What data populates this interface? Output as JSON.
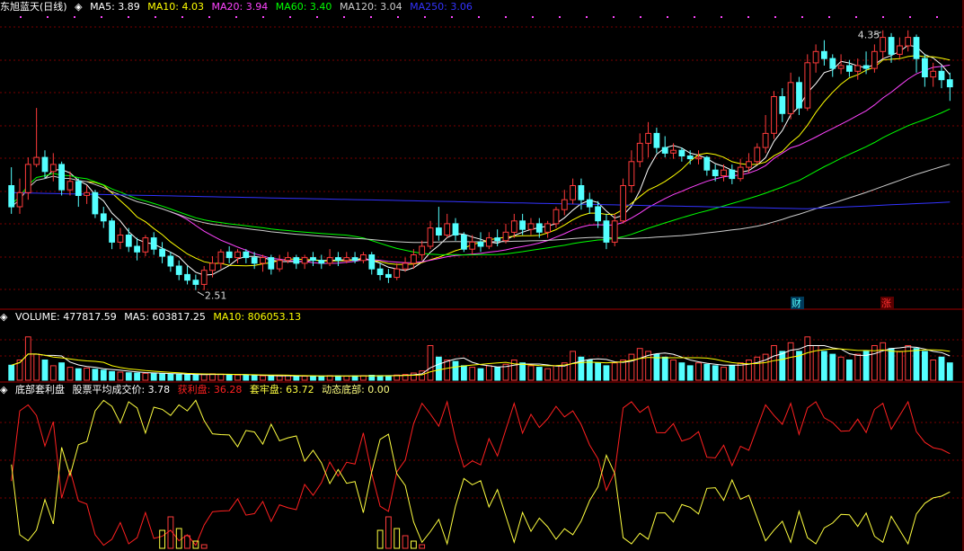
{
  "colors": {
    "up": "#ff3b3b",
    "down": "#54ffff",
    "grid": "#7a0000",
    "separator": "#a00000",
    "ma5": "#ffffff",
    "ma10": "#ffff00",
    "ma20": "#ff44ff",
    "ma60": "#00ff00",
    "ma120": "#cccccc",
    "ma250": "#3333ff",
    "profit": "#ff2020",
    "trapped": "#ffff40",
    "bottom": "#ffff80"
  },
  "price_panel": {
    "title": "东旭蓝天(日线)",
    "mas": [
      {
        "label": "MA5: 3.89",
        "color": "#ffffff"
      },
      {
        "label": "MA10: 4.03",
        "color": "#ffff00"
      },
      {
        "label": "MA20: 3.94",
        "color": "#ff44ff"
      },
      {
        "label": "MA60: 3.40",
        "color": "#00ff00"
      },
      {
        "label": "MA120: 3.04",
        "color": "#cccccc"
      },
      {
        "label": "MA250: 3.06",
        "color": "#3333ff"
      }
    ],
    "high_label": "4.35",
    "low_label": "2.51",
    "markers": [
      {
        "text": "财",
        "color": "#54ffff",
        "bg": "#003a5a"
      },
      {
        "text": "涨",
        "color": "#ff3030",
        "bg": "#5a0000"
      }
    ]
  },
  "volume_panel": {
    "title": "VOLUME: 477817.59",
    "ma5": "MA5: 603817.25",
    "ma10": "MA10: 806053.13"
  },
  "indicator_panel": {
    "title": "底部套利盘",
    "avg": "股票平均成交价: 3.78",
    "profit": "获利盘: 36.28",
    "trapped": "套牢盘: 63.72",
    "bottom": "动态底部: 0.00"
  },
  "chart_data": {
    "type": "candlestick",
    "price_range": [
      2.4,
      4.45
    ],
    "price_high": 4.35,
    "price_low": 2.51,
    "candles": [
      [
        3.25,
        3.1,
        3.38,
        3.05
      ],
      [
        3.1,
        3.2,
        3.3,
        3.05
      ],
      [
        3.2,
        3.4,
        3.45,
        3.15
      ],
      [
        3.4,
        3.45,
        3.8,
        3.38
      ],
      [
        3.45,
        3.35,
        3.5,
        3.3
      ],
      [
        3.35,
        3.4,
        3.48,
        3.28
      ],
      [
        3.4,
        3.22,
        3.42,
        3.18
      ],
      [
        3.22,
        3.28,
        3.35,
        3.18
      ],
      [
        3.28,
        3.18,
        3.3,
        3.1
      ],
      [
        3.18,
        3.2,
        3.25,
        3.12
      ],
      [
        3.2,
        3.05,
        3.22,
        3.02
      ],
      [
        3.05,
        3.0,
        3.1,
        2.95
      ],
      [
        3.0,
        2.85,
        3.02,
        2.8
      ],
      [
        2.85,
        2.9,
        2.95,
        2.8
      ],
      [
        2.9,
        2.82,
        2.95,
        2.78
      ],
      [
        2.82,
        2.78,
        2.88,
        2.72
      ],
      [
        2.78,
        2.88,
        2.9,
        2.75
      ],
      [
        2.88,
        2.8,
        2.92,
        2.76
      ],
      [
        2.8,
        2.75,
        2.85,
        2.7
      ],
      [
        2.75,
        2.68,
        2.78,
        2.64
      ],
      [
        2.68,
        2.62,
        2.72,
        2.58
      ],
      [
        2.62,
        2.58,
        2.68,
        2.55
      ],
      [
        2.58,
        2.55,
        2.62,
        2.51
      ],
      [
        2.55,
        2.65,
        2.68,
        2.51
      ],
      [
        2.65,
        2.7,
        2.75,
        2.6
      ],
      [
        2.7,
        2.78,
        2.8,
        2.66
      ],
      [
        2.78,
        2.74,
        2.82,
        2.7
      ],
      [
        2.74,
        2.78,
        2.8,
        2.7
      ],
      [
        2.78,
        2.74,
        2.8,
        2.7
      ],
      [
        2.74,
        2.7,
        2.78,
        2.66
      ],
      [
        2.7,
        2.74,
        2.76,
        2.64
      ],
      [
        2.74,
        2.66,
        2.76,
        2.62
      ],
      [
        2.66,
        2.72,
        2.76,
        2.64
      ],
      [
        2.72,
        2.74,
        2.78,
        2.7
      ],
      [
        2.74,
        2.7,
        2.76,
        2.66
      ],
      [
        2.7,
        2.74,
        2.76,
        2.66
      ],
      [
        2.74,
        2.72,
        2.78,
        2.68
      ],
      [
        2.72,
        2.7,
        2.76,
        2.66
      ],
      [
        2.7,
        2.74,
        2.8,
        2.68
      ],
      [
        2.74,
        2.72,
        2.78,
        2.68
      ],
      [
        2.72,
        2.74,
        2.78,
        2.7
      ],
      [
        2.74,
        2.72,
        2.78,
        2.7
      ],
      [
        2.72,
        2.76,
        2.78,
        2.7
      ],
      [
        2.76,
        2.66,
        2.78,
        2.62
      ],
      [
        2.66,
        2.62,
        2.7,
        2.58
      ],
      [
        2.62,
        2.6,
        2.66,
        2.56
      ],
      [
        2.6,
        2.66,
        2.7,
        2.58
      ],
      [
        2.66,
        2.7,
        2.74,
        2.64
      ],
      [
        2.7,
        2.76,
        2.8,
        2.66
      ],
      [
        2.76,
        2.82,
        2.86,
        2.72
      ],
      [
        2.82,
        2.95,
        3.0,
        2.8
      ],
      [
        2.95,
        2.9,
        3.1,
        2.86
      ],
      [
        2.9,
        2.98,
        3.05,
        2.88
      ],
      [
        2.98,
        2.9,
        3.02,
        2.86
      ],
      [
        2.9,
        2.8,
        2.92,
        2.78
      ],
      [
        2.8,
        2.85,
        2.9,
        2.76
      ],
      [
        2.85,
        2.82,
        2.92,
        2.78
      ],
      [
        2.82,
        2.88,
        2.92,
        2.8
      ],
      [
        2.88,
        2.86,
        2.94,
        2.82
      ],
      [
        2.86,
        2.92,
        2.98,
        2.84
      ],
      [
        2.92,
        3.0,
        3.05,
        2.88
      ],
      [
        3.0,
        2.94,
        3.05,
        2.9
      ],
      [
        2.94,
        2.98,
        3.02,
        2.9
      ],
      [
        2.98,
        2.92,
        3.02,
        2.88
      ],
      [
        2.92,
        2.98,
        3.0,
        2.88
      ],
      [
        2.98,
        3.08,
        3.1,
        2.95
      ],
      [
        3.08,
        3.15,
        3.22,
        3.04
      ],
      [
        3.15,
        3.25,
        3.3,
        3.12
      ],
      [
        3.25,
        3.15,
        3.3,
        3.08
      ],
      [
        3.15,
        3.1,
        3.2,
        3.05
      ],
      [
        3.1,
        3.0,
        3.14,
        2.95
      ],
      [
        3.0,
        2.85,
        3.05,
        2.8
      ],
      [
        2.85,
        3.0,
        3.05,
        2.82
      ],
      [
        3.0,
        3.25,
        3.3,
        2.98
      ],
      [
        3.25,
        3.42,
        3.5,
        3.2
      ],
      [
        3.42,
        3.55,
        3.62,
        3.38
      ],
      [
        3.55,
        3.62,
        3.7,
        3.45
      ],
      [
        3.62,
        3.52,
        3.66,
        3.48
      ],
      [
        3.52,
        3.48,
        3.6,
        3.45
      ],
      [
        3.48,
        3.5,
        3.55,
        3.44
      ],
      [
        3.5,
        3.46,
        3.52,
        3.42
      ],
      [
        3.46,
        3.44,
        3.5,
        3.4
      ],
      [
        3.44,
        3.45,
        3.5,
        3.4
      ],
      [
        3.45,
        3.36,
        3.46,
        3.32
      ],
      [
        3.36,
        3.32,
        3.4,
        3.28
      ],
      [
        3.32,
        3.36,
        3.4,
        3.28
      ],
      [
        3.36,
        3.3,
        3.4,
        3.26
      ],
      [
        3.3,
        3.38,
        3.44,
        3.28
      ],
      [
        3.38,
        3.42,
        3.48,
        3.34
      ],
      [
        3.42,
        3.52,
        3.55,
        3.4
      ],
      [
        3.52,
        3.62,
        3.75,
        3.48
      ],
      [
        3.62,
        3.88,
        3.92,
        3.58
      ],
      [
        3.88,
        3.76,
        3.94,
        3.7
      ],
      [
        3.76,
        3.98,
        4.05,
        3.72
      ],
      [
        3.98,
        3.8,
        4.02,
        3.75
      ],
      [
        3.8,
        4.12,
        4.18,
        3.78
      ],
      [
        4.12,
        4.2,
        4.25,
        4.05
      ],
      [
        4.2,
        4.15,
        4.28,
        4.1
      ],
      [
        4.15,
        4.08,
        4.18,
        4.02
      ],
      [
        4.08,
        4.1,
        4.18,
        4.04
      ],
      [
        4.1,
        4.06,
        4.14,
        4.02
      ],
      [
        4.06,
        4.1,
        4.15,
        4.0
      ],
      [
        4.1,
        4.08,
        4.2,
        4.04
      ],
      [
        4.08,
        4.2,
        4.25,
        4.05
      ],
      [
        4.2,
        4.3,
        4.35,
        4.15
      ],
      [
        4.3,
        4.18,
        4.33,
        4.12
      ],
      [
        4.18,
        4.24,
        4.3,
        4.15
      ],
      [
        4.24,
        4.3,
        4.35,
        4.2
      ],
      [
        4.3,
        4.15,
        4.32,
        4.05
      ],
      [
        4.15,
        4.02,
        4.18,
        3.95
      ],
      [
        4.02,
        4.06,
        4.12,
        3.95
      ],
      [
        4.06,
        4.0,
        4.1,
        3.94
      ],
      [
        4.0,
        3.95,
        4.05,
        3.85
      ]
    ],
    "volume_range": [
      0,
      1900000
    ],
    "volumes": [
      520000,
      700000,
      1500000,
      900000,
      700000,
      500000,
      600000,
      450000,
      400000,
      420000,
      380000,
      350000,
      300000,
      280000,
      260000,
      250000,
      240000,
      230000,
      220000,
      210000,
      200000,
      190000,
      180000,
      200000,
      220000,
      210000,
      190000,
      180000,
      170000,
      160000,
      150000,
      140000,
      150000,
      160000,
      150000,
      140000,
      150000,
      140000,
      160000,
      150000,
      140000,
      150000,
      160000,
      170000,
      160000,
      150000,
      180000,
      200000,
      250000,
      320000,
      1200000,
      800000,
      700000,
      650000,
      500000,
      450000,
      400000,
      500000,
      450000,
      550000,
      700000,
      600000,
      500000,
      450000,
      400000,
      500000,
      600000,
      1000000,
      800000,
      700000,
      600000,
      500000,
      600000,
      700000,
      900000,
      1100000,
      1000000,
      900000,
      800000,
      700000,
      600000,
      500000,
      600000,
      550000,
      500000,
      450000,
      500000,
      600000,
      700000,
      800000,
      900000,
      1200000,
      1000000,
      1300000,
      1000000,
      1500000,
      1200000,
      1000000,
      900000,
      800000,
      700000,
      900000,
      1000000,
      1200000,
      1300000,
      1100000,
      1000000,
      1200000,
      1100000,
      1000000,
      700000,
      800000,
      600000
    ],
    "indicator_range": [
      0,
      100
    ]
  }
}
